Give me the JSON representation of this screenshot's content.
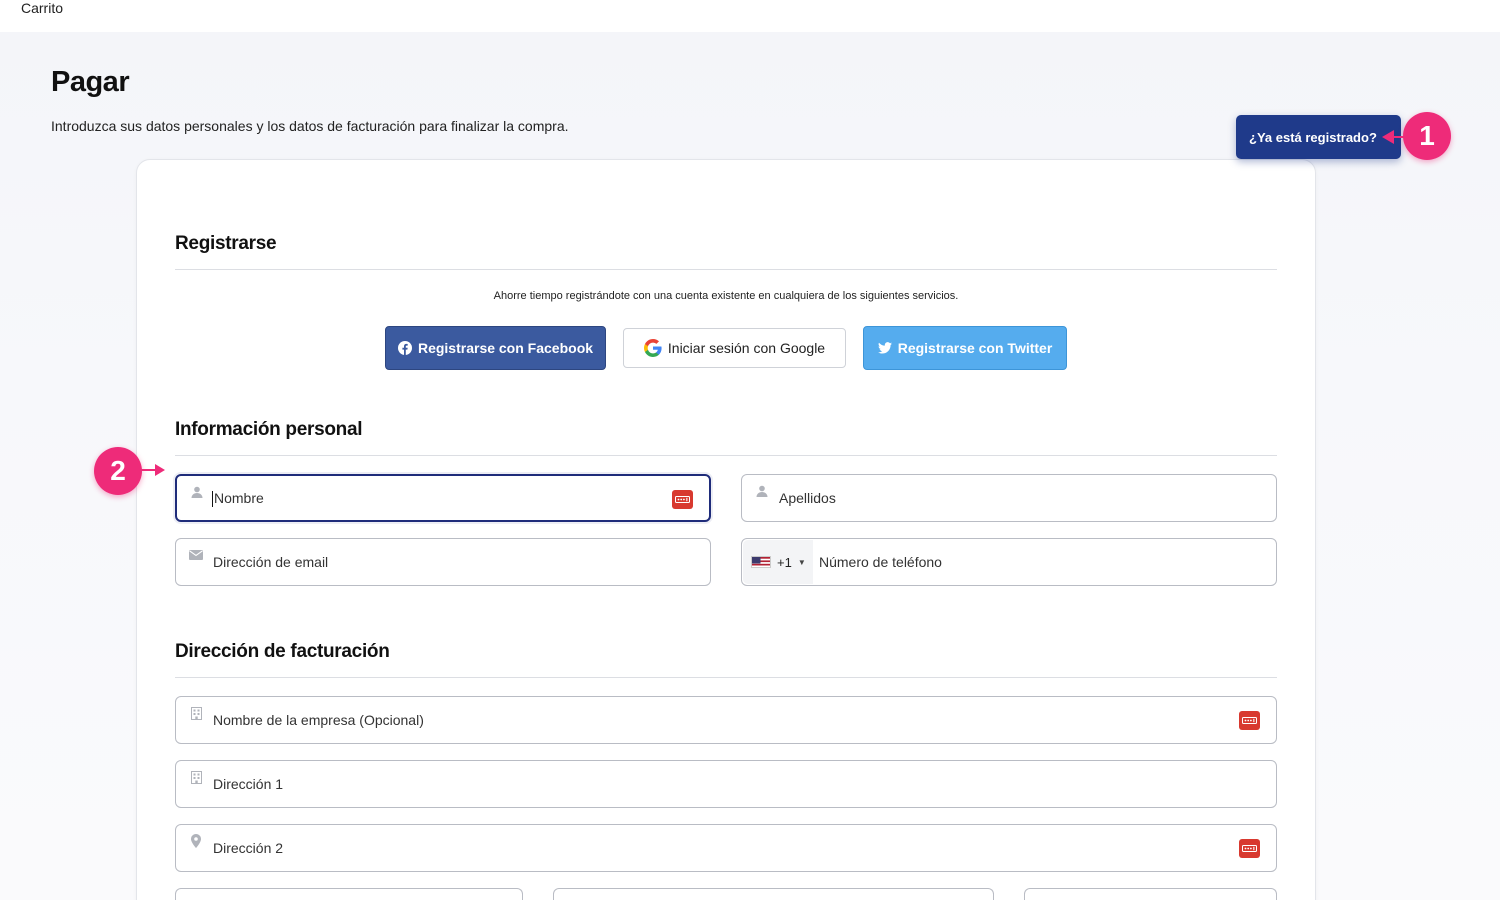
{
  "topbar": {
    "breadcrumb": "Carrito"
  },
  "page": {
    "title": "Pagar",
    "subtitle": "Introduzca sus datos personales y los datos de facturación para finalizar la compra.",
    "already_registered_label": "¿Ya está registrado?"
  },
  "markers": {
    "one": "1",
    "two": "2"
  },
  "register": {
    "title": "Registrarse",
    "hint": "Ahorre tiempo registrándote con una cuenta existente en cualquiera de los siguientes servicios.",
    "facebook_label": "Registrarse con Facebook",
    "google_label": "Iniciar sesión con Google",
    "twitter_label": "Registrarse con Twitter"
  },
  "personal": {
    "title": "Información personal",
    "first_name_placeholder": "Nombre",
    "last_name_placeholder": "Apellidos",
    "email_placeholder": "Dirección de email",
    "phone_code": "+1",
    "phone_placeholder": "Número de teléfono"
  },
  "billing": {
    "title": "Dirección de facturación",
    "company_placeholder": "Nombre de la empresa (Opcional)",
    "address1_placeholder": "Dirección 1",
    "address2_placeholder": "Dirección 2"
  },
  "colors": {
    "primary": "#1f3a8a",
    "marker": "#ee2b79",
    "facebook": "#3b5a9f",
    "twitter": "#55acee",
    "password_manager": "#d8392f"
  },
  "icons": [
    "user-icon",
    "mail-icon",
    "building-icon",
    "location-pin-icon",
    "password-manager-icon",
    "facebook-icon",
    "google-icon",
    "twitter-icon",
    "us-flag-icon"
  ]
}
